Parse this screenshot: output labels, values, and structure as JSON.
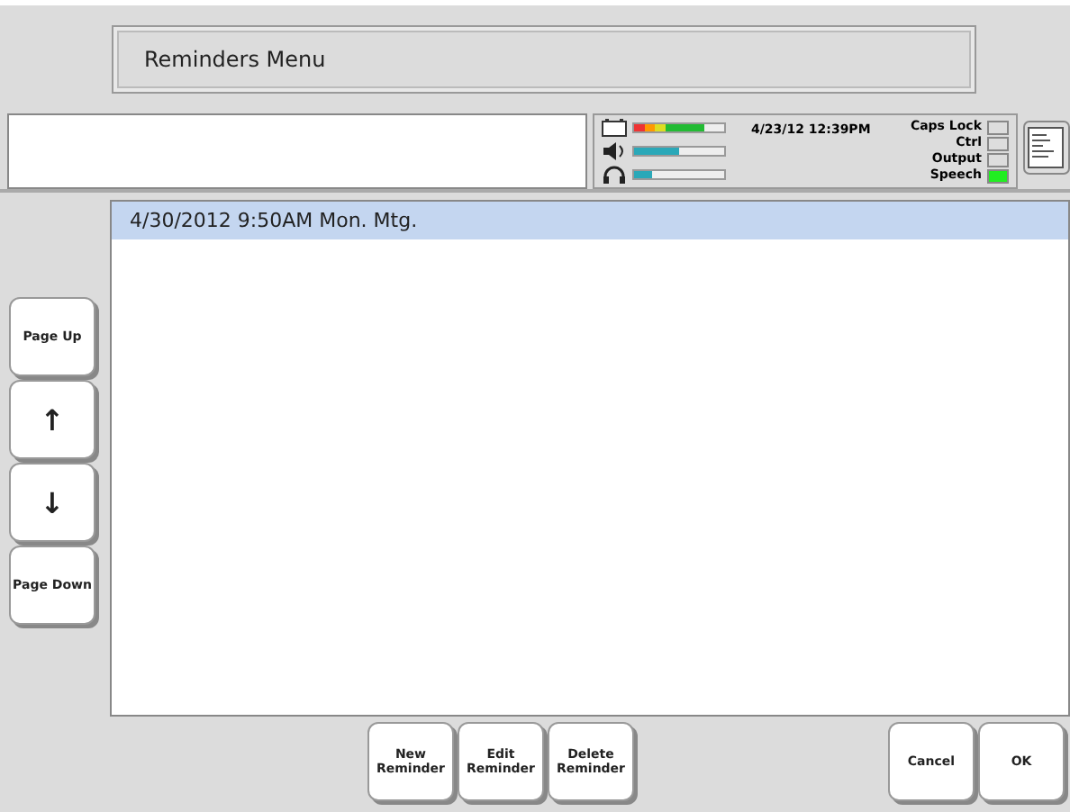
{
  "title": "Reminders Menu",
  "status": {
    "battery": {
      "level": 0.78
    },
    "volume": {
      "level": 0.5
    },
    "headphone": {
      "level": 0.2
    },
    "datetime": "4/23/12 12:39PM",
    "toggles": [
      {
        "label": "Caps Lock",
        "on": false
      },
      {
        "label": "Ctrl",
        "on": false
      },
      {
        "label": "Output",
        "on": false
      },
      {
        "label": "Speech",
        "on": true
      }
    ]
  },
  "nav_buttons": [
    {
      "kind": "text",
      "label": "Page Up"
    },
    {
      "kind": "arrow",
      "label": "↑"
    },
    {
      "kind": "arrow",
      "label": "↓"
    },
    {
      "kind": "text",
      "label": "Page Down"
    }
  ],
  "reminders": [
    {
      "text": "4/30/2012 9:50AM  Mon. Mtg.",
      "selected": true
    }
  ],
  "actions": [
    {
      "label": "New Reminder"
    },
    {
      "label": "Edit Reminder"
    },
    {
      "label": "Delete Reminder"
    }
  ],
  "dialog_buttons": [
    {
      "label": "Cancel"
    },
    {
      "label": "OK"
    }
  ]
}
